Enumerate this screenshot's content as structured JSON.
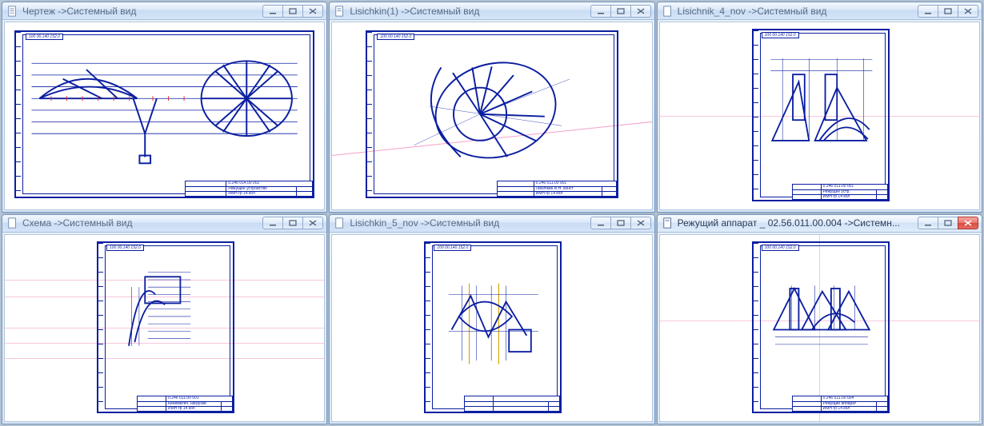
{
  "windows": [
    {
      "id": "w1",
      "title": "Чертеж ->Системный вид",
      "active": false,
      "orientation": "landscape",
      "topbar_code": "100 00.140 152.0",
      "titleblock_code": "0.246 014.00 002",
      "titleblock_lines": [
        "Режущее устройство",
        "ИМН гр 14 кол"
      ]
    },
    {
      "id": "w2",
      "title": "Lisichkin(1) ->Системный вид",
      "active": false,
      "orientation": "landscape",
      "topbar_code": "100 00.140 152.0",
      "titleblock_code": "0.246 011.00 001",
      "titleblock_lines": [
        "Лисичкин И.Н. конст",
        "ИМН гр 14 кол"
      ]
    },
    {
      "id": "w3",
      "title": "Lisichnik_4_nov ->Системный вид",
      "active": false,
      "orientation": "portrait",
      "topbar_code": "100 00.140 152.0",
      "titleblock_code": "0.246 011.00 001",
      "titleblock_lines": [
        "Режущее устр.",
        "ИМН гр 14 кол"
      ]
    },
    {
      "id": "w4",
      "title": "Схема ->Системный вид",
      "active": false,
      "orientation": "portrait",
      "topbar_code": "100 00.140 152.0",
      "titleblock_code": "0.246 011.00 001",
      "titleblock_lines": [
        "Кинематич. нагрузки",
        "ИМН гр 14 кол"
      ]
    },
    {
      "id": "w5",
      "title": "Lisichkin_5_nov ->Системный вид",
      "active": false,
      "orientation": "portrait",
      "topbar_code": "100 00.140 152.0",
      "titleblock_code": "",
      "titleblock_lines": [
        "",
        ""
      ]
    },
    {
      "id": "w6",
      "title": "Режущий аппарат _ 02.56.011.00.004 ->Системн...",
      "active": true,
      "orientation": "portrait",
      "topbar_code": "100 00.140 152.0",
      "titleblock_code": "0.246 011.00 004",
      "titleblock_lines": [
        "Режущий аппарат",
        "ИМН гр 14 кол"
      ]
    }
  ],
  "controls": {
    "minimize_tooltip": "Свернуть",
    "maximize_tooltip": "Развернуть",
    "close_tooltip": "Закрыть"
  },
  "colors": {
    "frame_blue": "#0b1ea0",
    "construction_pink": "#f4a0c8",
    "marker_red": "#e03030"
  }
}
